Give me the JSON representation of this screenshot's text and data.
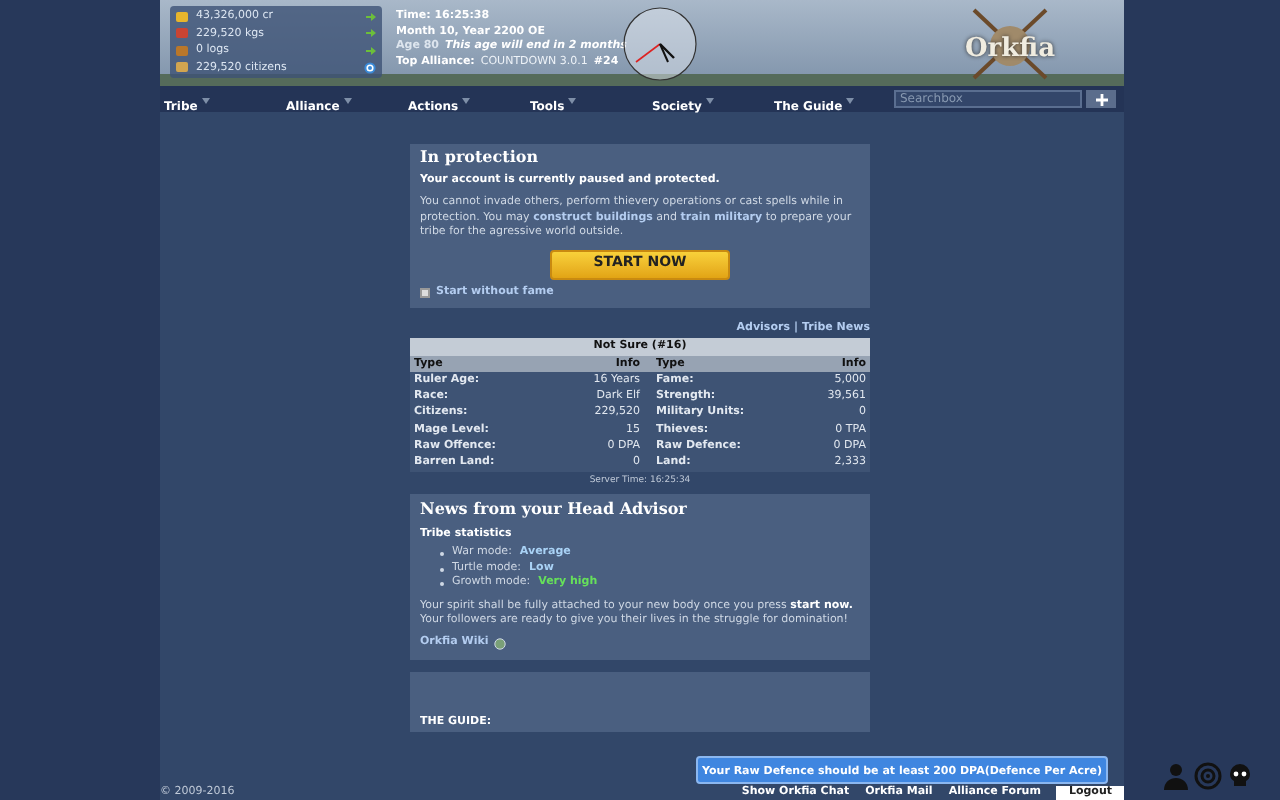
{
  "header": {
    "resources": [
      {
        "kind": "gold",
        "text": "43,326,000 cr"
      },
      {
        "kind": "food",
        "text": "229,520 kgs"
      },
      {
        "kind": "wood",
        "text": "0 logs"
      },
      {
        "kind": "people",
        "text": "229,520 citizens"
      }
    ],
    "time": "Time: 16:25:38",
    "month": "Month 10, Year 2200 OE",
    "age": {
      "label": "Age 80",
      "note": "This age will end in 2 months"
    },
    "top_alliance": {
      "label": "Top Alliance:",
      "name": "COUNTDOWN 3.0.1",
      "rank": "#24"
    },
    "logo": "Orkfia"
  },
  "nav": {
    "items": [
      "Tribe",
      "Alliance",
      "Actions",
      "Tools",
      "Society",
      "The Guide"
    ],
    "search": {
      "placeholder": "Searchbox"
    }
  },
  "protection": {
    "title": "In protection",
    "lead": "Your account is currently paused and protected.",
    "text": "You cannot invade others, perform thievery operations or cast spells while in protection. You may **construct buildings** and **train military** to prepare your tribe for the agressive world outside.",
    "button": "START NOW",
    "checkbox": {
      "label": "Start without fame",
      "checked": false
    }
  },
  "links": {
    "items": [
      "Advisors",
      "Tribe News"
    ],
    "separator": "|"
  },
  "tribe_table": {
    "title": "Not Sure (#16)",
    "columns": [
      "Type",
      "Info",
      "Type",
      "Info"
    ],
    "rows": [
      [
        "Ruler Age:",
        "16 Years",
        "Fame:",
        "5,000"
      ],
      [
        "Race:",
        "Dark Elf",
        "Strength:",
        "39,561"
      ],
      [
        "Citizens:",
        "229,520",
        "Military Units:",
        "0"
      ],
      [
        "Mage Level:",
        "15",
        "Thieves:",
        "0 TPA"
      ],
      [
        "Raw Offence:",
        "0 DPA",
        "Raw Defence:",
        "0 DPA"
      ],
      [
        "Barren Land:",
        "0",
        "Land:",
        "2,333"
      ]
    ]
  },
  "server_time": "Server Time: 16:25:34",
  "news": {
    "title": "News from your Head Advisor",
    "subtitle": "Tribe statistics",
    "stats": [
      {
        "label": "War mode:",
        "value": "Average",
        "color": "#a9d2f5"
      },
      {
        "label": "Turtle mode:",
        "value": "Low",
        "color": "#a9d2f5"
      },
      {
        "label": "Growth mode:",
        "value": "Very high",
        "color": "#66e05a"
      }
    ],
    "text": "Your spirit shall be fully attached to your new body once you press **start now.** Your followers are ready to give you their lives in the struggle for domination!",
    "wiki": "Orkfia Wiki"
  },
  "guide": {
    "title": "THE GUIDE:"
  },
  "notification": "Your Raw Defence should be at least 200 DPA(Defence Per Acre)",
  "footer": {
    "copyright": "© 2009-2016",
    "links": [
      "Show Orkfia Chat",
      "Orkfia Mail",
      "Alliance Forum"
    ],
    "logout": "Logout"
  }
}
